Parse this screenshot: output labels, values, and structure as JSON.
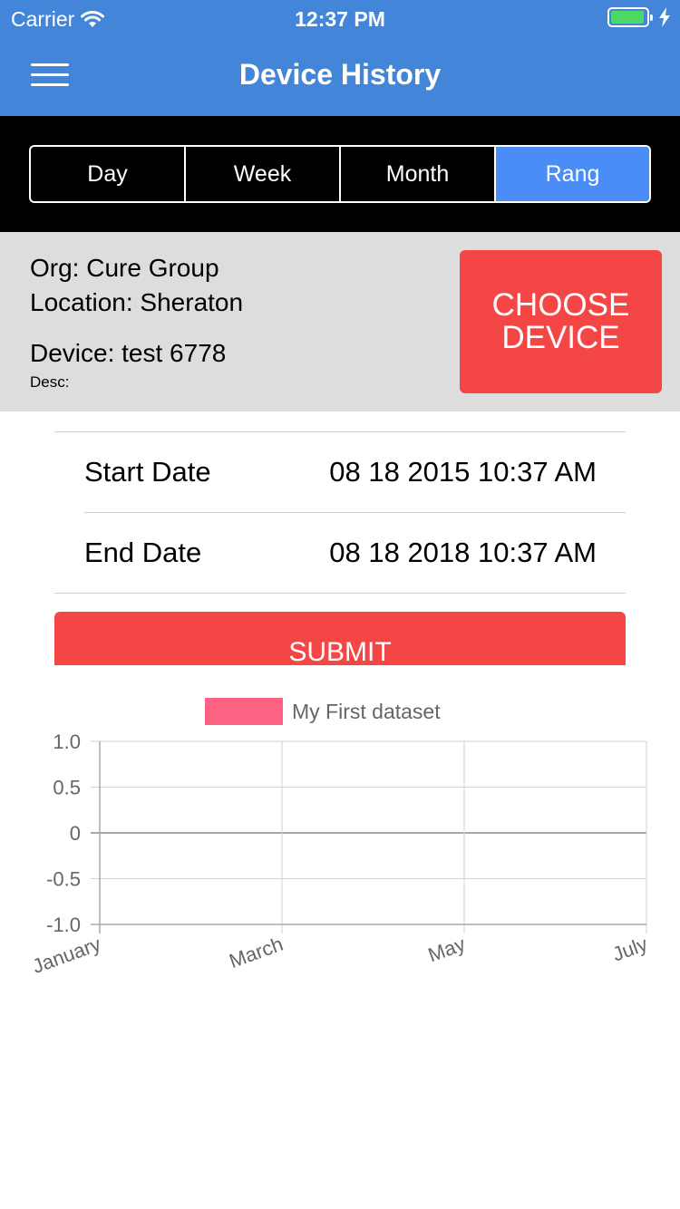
{
  "status_bar": {
    "carrier": "Carrier",
    "time": "12:37 PM"
  },
  "nav": {
    "title": "Device History"
  },
  "segments": [
    {
      "label": "Day",
      "active": false
    },
    {
      "label": "Week",
      "active": false
    },
    {
      "label": "Month",
      "active": false
    },
    {
      "label": "Rang",
      "active": true
    }
  ],
  "info": {
    "org": "Org: Cure Group",
    "location": "Location: Sheraton",
    "device": "Device: test 6778",
    "desc": "Desc:",
    "choose_button_line1": "CHOOSE",
    "choose_button_line2": "DEVICE"
  },
  "dates": {
    "start_label": "Start Date",
    "start_value": "08 18 2015 10:37 AM",
    "end_label": "End Date",
    "end_value": "08 18 2018 10:37 AM"
  },
  "submit_label": "SUBMIT",
  "colors": {
    "header": "#4285d9",
    "active_segment": "#4a8df7",
    "accent_red": "#f54646",
    "legend_swatch": "#ff6384"
  },
  "chart_data": {
    "type": "line",
    "legend": {
      "placement": "top-center",
      "entries": [
        "My First dataset"
      ]
    },
    "categories": [
      "January",
      "March",
      "May",
      "July"
    ],
    "series": [
      {
        "name": "My First dataset",
        "values": []
      }
    ],
    "y_ticks": [
      "1.0",
      "0.5",
      "0",
      "-0.5",
      "-1.0"
    ],
    "y_tick_values": [
      1.0,
      0.5,
      0,
      -0.5,
      -1.0
    ],
    "ylim": [
      -1.0,
      1.0
    ],
    "grid": true
  }
}
